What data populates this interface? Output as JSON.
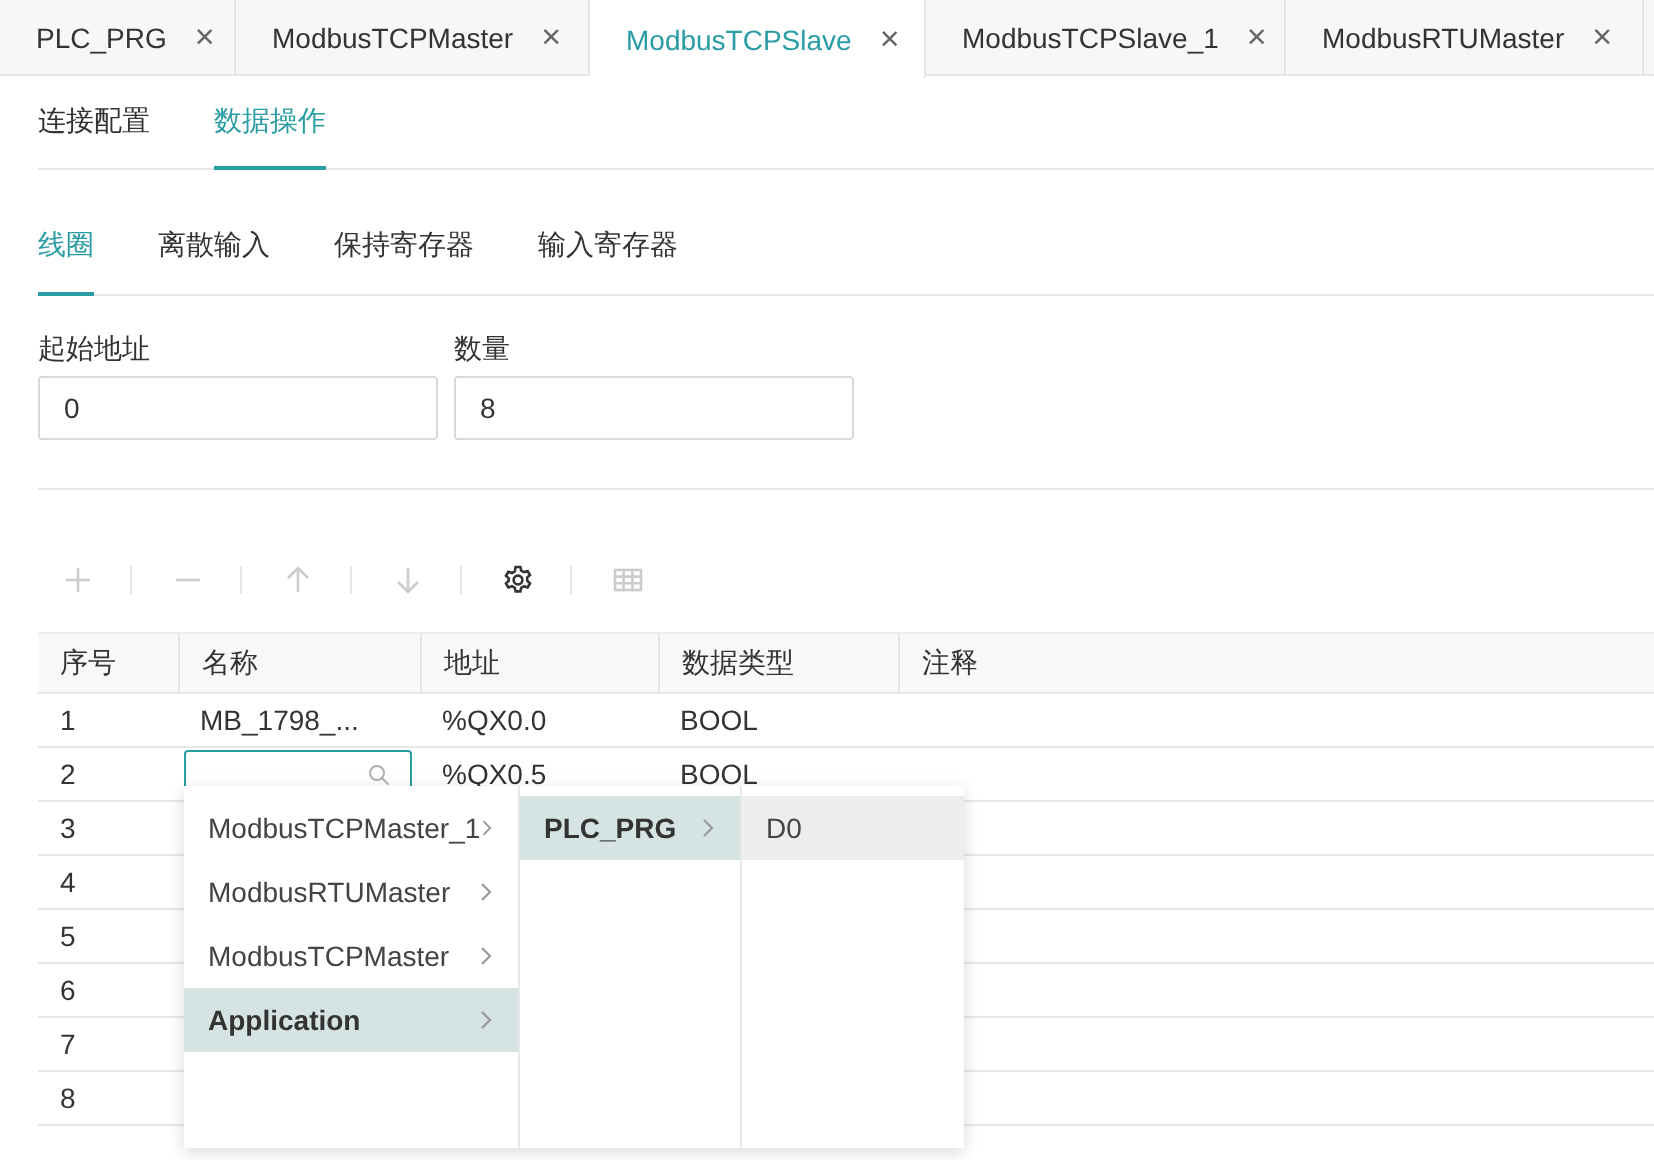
{
  "tabs": [
    {
      "label": "PLC_PRG",
      "close": "×",
      "selected": false
    },
    {
      "label": "ModbusTCPMaster",
      "close": "×",
      "selected": false
    },
    {
      "label": "ModbusTCPSlave",
      "close": "×",
      "selected": true
    },
    {
      "label": "ModbusTCPSlave_1",
      "close": "×",
      "selected": false
    },
    {
      "label": "ModbusRTUMaster",
      "close": "×",
      "selected": false
    }
  ],
  "subtabs": [
    {
      "label": "连接配置",
      "selected": false
    },
    {
      "label": "数据操作",
      "selected": true
    }
  ],
  "register_tabs": [
    {
      "label": "线圈",
      "selected": true
    },
    {
      "label": "离散输入",
      "selected": false
    },
    {
      "label": "保持寄存器",
      "selected": false
    },
    {
      "label": "输入寄存器",
      "selected": false
    }
  ],
  "fields": [
    {
      "label": "起始地址",
      "value": "0"
    },
    {
      "label": "数量",
      "value": "8"
    }
  ],
  "toolbar": [
    {
      "kind": "add",
      "disabled": true
    },
    {
      "kind": "remove",
      "disabled": true
    },
    {
      "kind": "up",
      "disabled": true
    },
    {
      "kind": "down",
      "disabled": true
    },
    {
      "kind": "settings",
      "disabled": false
    },
    {
      "kind": "grid",
      "disabled": true
    }
  ],
  "table": {
    "columns": [
      "序号",
      "名称",
      "地址",
      "数据类型",
      "注释"
    ],
    "rows": [
      {
        "index": "1",
        "name": "MB_1798_...",
        "address": "%QX0.0",
        "type": "BOOL",
        "editing": false
      },
      {
        "index": "2",
        "address": "%QX0.5",
        "type": "BOOL",
        "editing": true
      },
      {
        "index": "3"
      },
      {
        "index": "4"
      },
      {
        "index": "5"
      },
      {
        "index": "6"
      },
      {
        "index": "7"
      },
      {
        "index": "8"
      }
    ]
  },
  "cascader": [
    [
      {
        "label": "ModbusTCPMaster_1",
        "has_children": true,
        "selected": false,
        "hovered": false
      },
      {
        "label": "ModbusRTUMaster",
        "has_children": true,
        "selected": false,
        "hovered": false
      },
      {
        "label": "ModbusTCPMaster",
        "has_children": true,
        "selected": false,
        "hovered": false
      },
      {
        "label": "Application",
        "has_children": true,
        "selected": true,
        "hovered": false
      }
    ],
    [
      {
        "label": "PLC_PRG",
        "has_children": true,
        "selected": true,
        "hovered": false
      }
    ],
    [
      {
        "label": "D0",
        "has_children": false,
        "selected": false,
        "hovered": true
      }
    ]
  ]
}
